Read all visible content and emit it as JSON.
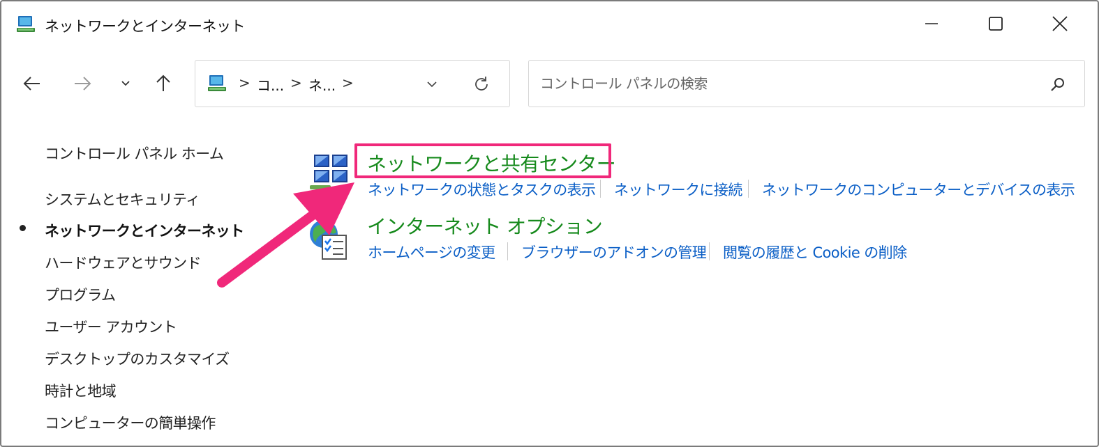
{
  "window": {
    "title": "ネットワークとインターネット",
    "controls": {
      "minimize": "minimize",
      "maximize": "maximize",
      "close": "close"
    }
  },
  "nav": {
    "breadcrumbs": [
      "コ...",
      "ネ..."
    ],
    "separator": ">"
  },
  "search": {
    "placeholder": "コントロール パネルの検索"
  },
  "sidebar": {
    "items": [
      {
        "label": "コントロール パネル ホーム",
        "active": false
      },
      {
        "label": "システムとセキュリティ",
        "active": false
      },
      {
        "label": "ネットワークとインターネット",
        "active": true
      },
      {
        "label": "ハードウェアとサウンド",
        "active": false
      },
      {
        "label": "プログラム",
        "active": false
      },
      {
        "label": "ユーザー アカウント",
        "active": false
      },
      {
        "label": "デスクトップのカスタマイズ",
        "active": false
      },
      {
        "label": "時計と地域",
        "active": false
      },
      {
        "label": "コンピューターの簡単操作",
        "active": false
      }
    ]
  },
  "categories": [
    {
      "title": "ネットワークと共有センター",
      "icon": "network-sharing-icon",
      "links": [
        "ネットワークの状態とタスクの表示",
        "ネットワークに接続",
        "ネットワークのコンピューターとデバイスの表示"
      ]
    },
    {
      "title": "インターネット オプション",
      "icon": "internet-options-icon",
      "links": [
        "ホームページの変更",
        "ブラウザーのアドオンの管理",
        "閲覧の履歴と Cookie の削除"
      ]
    }
  ],
  "annotation": {
    "highlight_color": "#f0287a"
  },
  "colors": {
    "category_title": "#168a1c",
    "link": "#0a5ec6"
  }
}
